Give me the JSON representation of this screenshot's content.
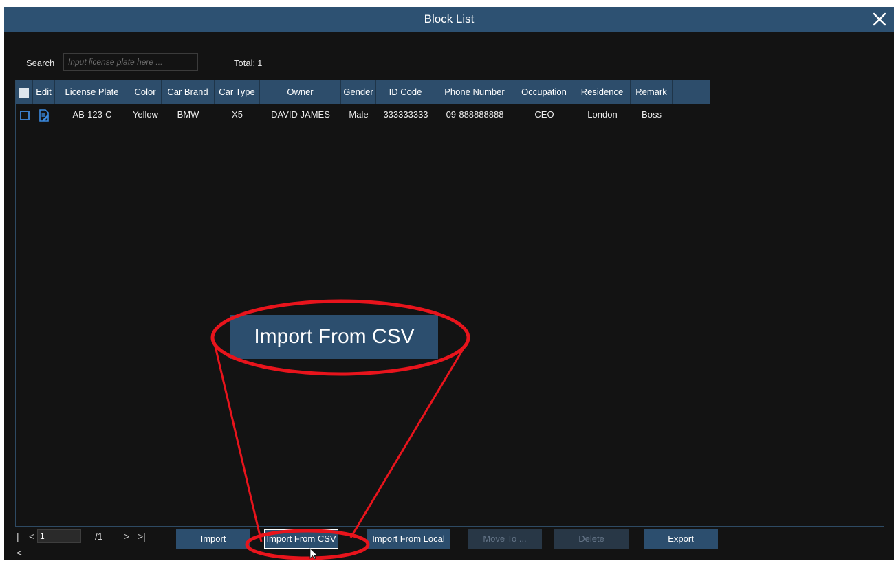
{
  "window": {
    "title": "Block List"
  },
  "search": {
    "label": "Search",
    "placeholder": "Input license plate here ...",
    "value": ""
  },
  "total": {
    "label": "Total:",
    "value": "1"
  },
  "table": {
    "columns": [
      "Edit",
      "License Plate",
      "Color",
      "Car Brand",
      "Car Type",
      "Owner",
      "Gender",
      "ID Code",
      "Phone Number",
      "Occupation",
      "Residence",
      "Remark"
    ],
    "rows": [
      {
        "license_plate": "AB-123-C",
        "color": "Yellow",
        "car_brand": "BMW",
        "car_type": "X5",
        "owner": "DAVID JAMES",
        "gender": "Male",
        "id_code": "333333333",
        "phone_number": "09-888888888",
        "occupation": "CEO",
        "residence": "London",
        "remark": "Boss"
      }
    ]
  },
  "pagination": {
    "first": "|<",
    "prev": "<",
    "current_page": "1",
    "total_pages": "/1",
    "next": ">",
    "last": ">|"
  },
  "buttons": {
    "import": "Import",
    "import_csv": "Import From CSV",
    "import_local": "Import From Local",
    "move_to": "Move To ...",
    "delete": "Delete",
    "export": "Export"
  },
  "callout": {
    "text": "Import From CSV"
  },
  "colors": {
    "title_bar": "#2d5172",
    "header": "#2d4d6b",
    "button": "#2c4e6e",
    "background": "#131313",
    "checkbox_accent": "#3a7bc8",
    "annotation": "#e8141c"
  },
  "icons": {
    "close": "close-icon",
    "edit": "edit-icon",
    "cursor": "mouse-pointer-icon"
  }
}
